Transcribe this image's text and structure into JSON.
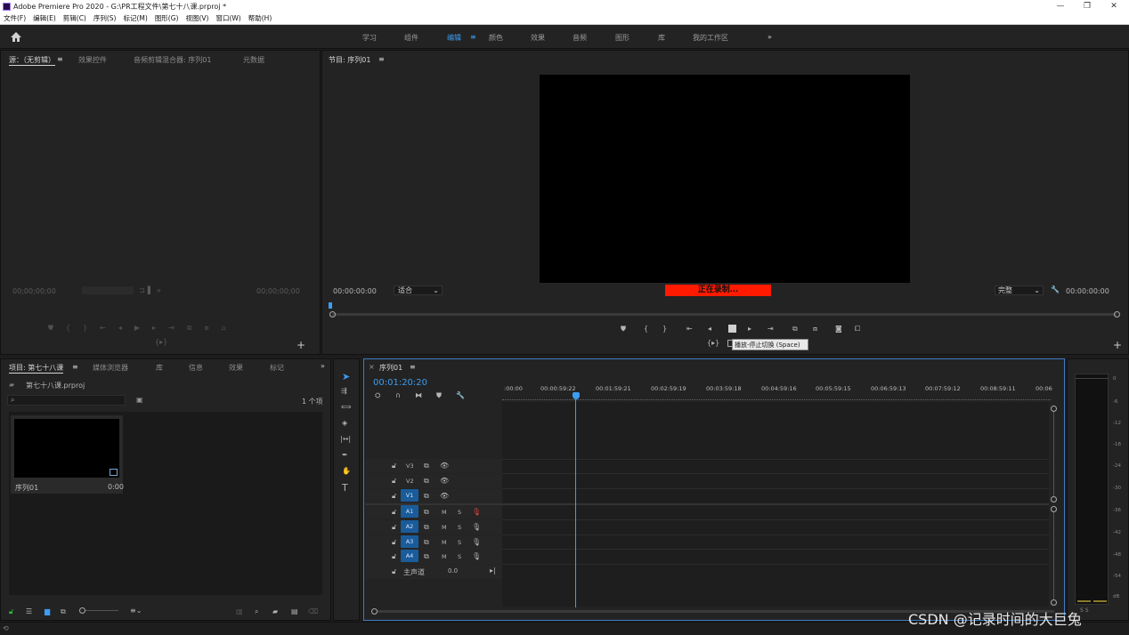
{
  "window": {
    "title": "Adobe Premiere Pro 2020 - G:\\PR工程文件\\第七十八课.prproj *"
  },
  "menu": [
    "文件(F)",
    "编辑(E)",
    "剪辑(C)",
    "序列(S)",
    "标记(M)",
    "图形(G)",
    "视图(V)",
    "窗口(W)",
    "帮助(H)"
  ],
  "workspaces": [
    "学习",
    "组件",
    "编辑",
    "颜色",
    "效果",
    "音频",
    "图形",
    "库",
    "我的工作区"
  ],
  "source_panel": {
    "tabs": [
      "源：（无剪辑）",
      "效果控件",
      "音频剪辑混合器: 序列01",
      "元数据"
    ],
    "timecode_left": "00;00;00;00",
    "timecode_right": "00;00;00;00"
  },
  "program_panel": {
    "title": "节目: 序列01",
    "timecode_left": "00:00:00:00",
    "fit": "适合",
    "recording": "正在录制...",
    "quality": "完整",
    "timecode_right": "00:00:00:00",
    "tooltip": "播放-停止切换 (Space)"
  },
  "project_panel": {
    "tabs": [
      "项目: 第七十八课",
      "媒体浏览器",
      "库",
      "信息",
      "效果",
      "标记"
    ],
    "project_file": "第七十八课.prproj",
    "item_count": "1 个项",
    "clip": {
      "name": "序列01",
      "duration": "0:00"
    }
  },
  "timeline": {
    "tab": "序列01",
    "playhead_timecode": "00:01:20:20",
    "ruler": [
      ":00:00",
      "00:00:59:22",
      "00:01:59:21",
      "00:02:59:19",
      "00:03:59:18",
      "00:04:59:16",
      "00:05:59:15",
      "00:06:59:13",
      "00:07:59:12",
      "00:08:59:11",
      "00:06"
    ],
    "video_tracks": [
      "V3",
      "V2",
      "V1"
    ],
    "audio_tracks": [
      "A1",
      "A2",
      "A3",
      "A4"
    ],
    "source_patch": "A1",
    "master": {
      "label": "主声道",
      "value": "0.0"
    },
    "mute": "M",
    "solo": "S"
  },
  "meter": {
    "labels": [
      "0",
      "-6",
      "-12",
      "-18",
      "-24",
      "-30",
      "-36",
      "-42",
      "-48",
      "-54",
      "dB"
    ],
    "channels": "S S"
  },
  "watermark": "CSDN @记录时间的大巨兔",
  "colors": {
    "accent": "#3d9cf0",
    "record": "#ff1a00",
    "track_blue": "#1a5c9a"
  }
}
